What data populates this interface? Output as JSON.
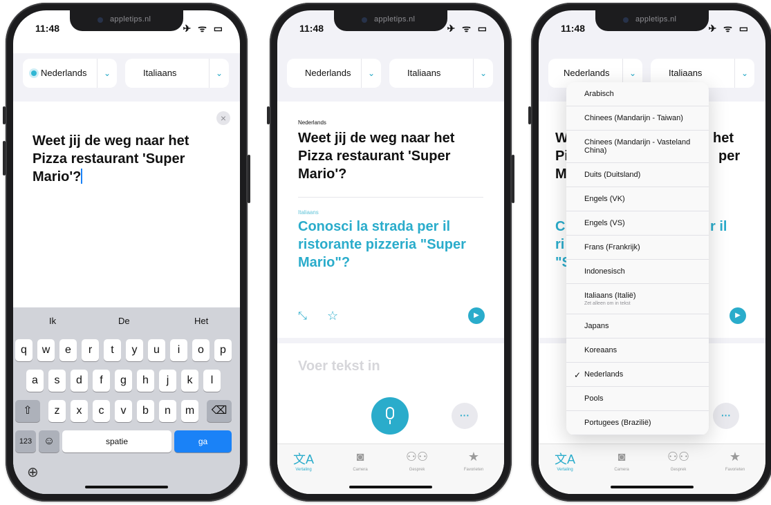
{
  "status": {
    "time": "11:48",
    "icons": "✈ ᯤ ▭",
    "watermark": "appletips.nl"
  },
  "phone1": {
    "source_lang": "Nederlands",
    "target_lang": "Italiaans",
    "input_text": "Weet jij de weg naar het Pizza restaurant 'Super Mario'?",
    "close_icon": "×",
    "suggestions": [
      "Ik",
      "De",
      "Het"
    ],
    "row1": [
      "q",
      "w",
      "e",
      "r",
      "t",
      "y",
      "u",
      "i",
      "o",
      "p"
    ],
    "row2": [
      "a",
      "s",
      "d",
      "f",
      "g",
      "h",
      "j",
      "k",
      "l"
    ],
    "row3": [
      "z",
      "x",
      "c",
      "v",
      "b",
      "n",
      "m"
    ],
    "shift": "⇧",
    "backspace": "⌫",
    "num_key": "123",
    "emoji_key": "☺",
    "space_key": "spatie",
    "go_key": "ga",
    "globe": "⊕"
  },
  "phone2": {
    "source_lang": "Nederlands",
    "target_lang": "Italiaans",
    "source_label": "Nederlands",
    "source_text": "Weet jij de weg naar het Pizza restaurant 'Super Mario'?",
    "target_label": "Italiaans",
    "target_text": "Conosci la strada per il ristorante pizzeria \"Super Mario\"?",
    "placeholder": "Voer tekst in"
  },
  "phone3": {
    "source_lang": "Nederlands",
    "target_lang": "Italiaans",
    "peek_text": [
      "We",
      "Pi",
      "M",
      "het",
      "per"
    ],
    "peek_trans": [
      "C",
      "ri",
      "\"S",
      "r il"
    ],
    "menu": [
      {
        "label": "Arabisch"
      },
      {
        "label": "Chinees (Mandarijn - Taiwan)"
      },
      {
        "label": "Chinees (Mandarijn - Vasteland China)"
      },
      {
        "label": "Duits (Duitsland)"
      },
      {
        "label": "Engels (VK)"
      },
      {
        "label": "Engels (VS)"
      },
      {
        "label": "Frans (Frankrijk)"
      },
      {
        "label": "Indonesisch"
      },
      {
        "label": "Italiaans (Italië)",
        "sub": "Zet alleen om in tekst"
      },
      {
        "label": "Japans"
      },
      {
        "label": "Koreaans"
      },
      {
        "label": "Nederlands",
        "checked": true
      },
      {
        "label": "Pools"
      },
      {
        "label": "Portugees (Brazilië)"
      }
    ]
  },
  "tabs": [
    "Vertaling",
    "Camera",
    "Gesprek",
    "Favorieten"
  ],
  "colors": {
    "accent": "#2aaccb",
    "go": "#1a82f7"
  }
}
